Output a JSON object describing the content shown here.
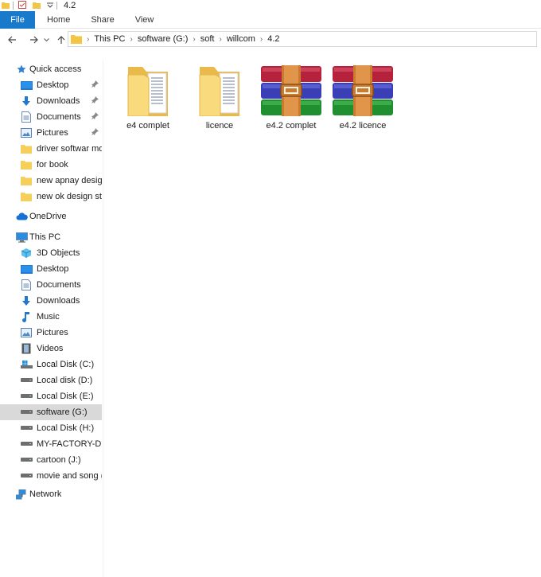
{
  "window": {
    "title": "4.2"
  },
  "ribbon": {
    "file": "File",
    "tabs": [
      "Home",
      "Share",
      "View"
    ]
  },
  "breadcrumb": [
    "This PC",
    "software (G:)",
    "soft",
    "willcom",
    "4.2"
  ],
  "nav": {
    "quick_access": "Quick access",
    "quick_items": [
      "Desktop",
      "Downloads",
      "Documents",
      "Pictures",
      "driver softwar mobi",
      "for book",
      "new apnay designs",
      "new ok design stich"
    ],
    "onedrive": "OneDrive",
    "this_pc": "This PC",
    "pc_items": [
      "3D Objects",
      "Desktop",
      "Documents",
      "Downloads",
      "Music",
      "Pictures",
      "Videos",
      "Local Disk (C:)",
      "Local disk (D:)",
      "Local Disk (E:)",
      "software (G:)",
      "Local Disk (H:)",
      "MY-FACTORY-DESIG",
      "cartoon (J:)",
      "movie and song (K:"
    ],
    "network": "Network"
  },
  "files": [
    {
      "name": "e4 complet",
      "type": "folder"
    },
    {
      "name": "licence",
      "type": "folder"
    },
    {
      "name": "e4.2 complet",
      "type": "archive"
    },
    {
      "name": "e4.2 licence",
      "type": "archive"
    }
  ],
  "colors": {
    "accent": "#1979ca",
    "folder": "#f7d774",
    "selected": "#d9d9d9"
  }
}
